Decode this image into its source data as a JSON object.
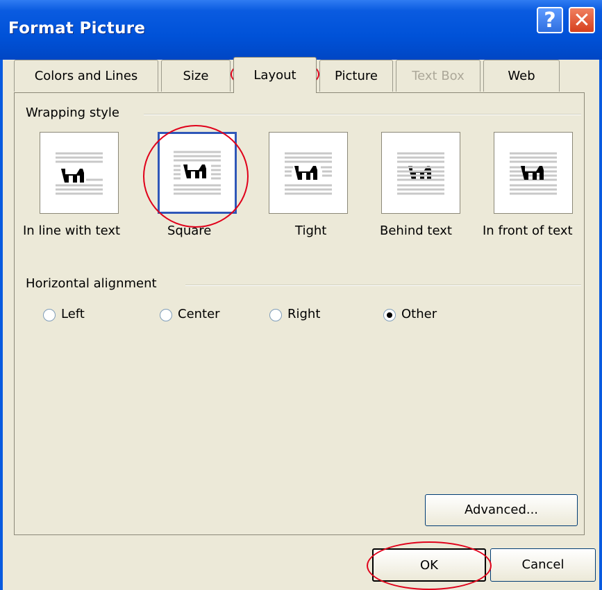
{
  "title": "Format Picture",
  "title_buttons": {
    "help": "?",
    "close": "✕"
  },
  "tabs": [
    {
      "label": "Colors and Lines",
      "state": "normal"
    },
    {
      "label": "Size",
      "state": "normal"
    },
    {
      "label": "Layout",
      "state": "active"
    },
    {
      "label": "Picture",
      "state": "normal"
    },
    {
      "label": "Text Box",
      "state": "disabled"
    },
    {
      "label": "Web",
      "state": "normal"
    }
  ],
  "wrapping": {
    "group_label": "Wrapping style",
    "options": [
      {
        "label": "In line with text",
        "icon": "inline-wrap-icon"
      },
      {
        "label": "Square",
        "icon": "square-wrap-icon",
        "selected": true
      },
      {
        "label": "Tight",
        "icon": "tight-wrap-icon"
      },
      {
        "label": "Behind text",
        "icon": "behind-text-icon"
      },
      {
        "label": "In front of text",
        "icon": "in-front-of-text-icon"
      }
    ]
  },
  "alignment": {
    "group_label": "Horizontal alignment",
    "options": [
      {
        "label": "Left",
        "checked": false
      },
      {
        "label": "Center",
        "checked": false
      },
      {
        "label": "Right",
        "checked": false
      },
      {
        "label": "Other",
        "checked": true
      }
    ]
  },
  "buttons": {
    "advanced": "Advanced...",
    "ok": "OK",
    "cancel": "Cancel"
  },
  "colors": {
    "title_bar": "#0a5be0",
    "face": "#ece9d8",
    "annotation": "#e0001a",
    "selection": "#2f57b8"
  }
}
